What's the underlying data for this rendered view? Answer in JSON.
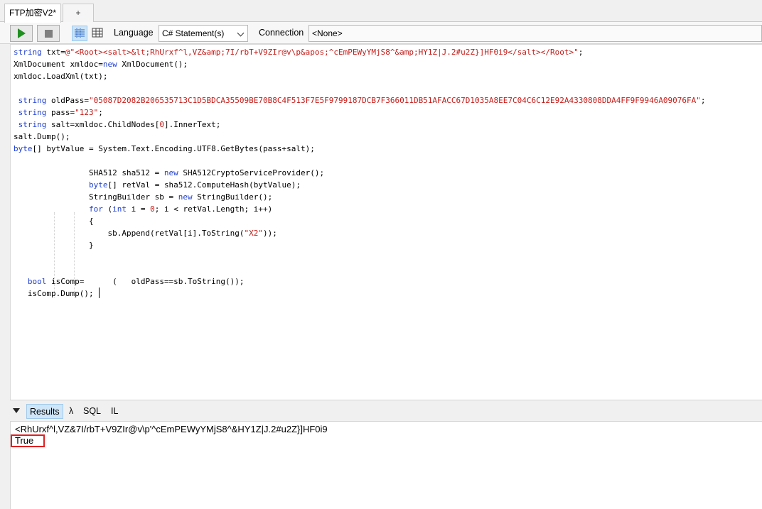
{
  "tabs": {
    "active_label": "FTP加密V2*",
    "new_tab_label": "+"
  },
  "toolbar": {
    "language_label": "Language",
    "language_value": "C# Statement(s)",
    "connection_label": "Connection",
    "connection_value": "<None>"
  },
  "editor": {
    "code_lines": [
      "string txt=@\"<Root><salt>&lt;RhUrxf^l,VZ&amp;7I/rbT+V9ZIr@v\\p&apos;^cEmPEWyYMjS8^&amp;HY1Z|J.2#u2Z}]HF0i9</salt></Root>\";",
      "XmlDocument xmldoc=new XmlDocument();",
      "xmldoc.LoadXml(txt);",
      "",
      " string oldPass=\"05087D2082B206535713C1D5BDCA35509BE70B8C4F513F7E5F9799187DCB7F366011DB51AFACC67D1035A8EE7C04C6C12E92A4330808DDA4FF9F9946A09076FA\";",
      " string pass=\"123\";",
      " string salt=xmldoc.ChildNodes[0].InnerText;",
      "salt.Dump();",
      "byte[] bytValue = System.Text.Encoding.UTF8.GetBytes(pass+salt);",
      "",
      "                SHA512 sha512 = new SHA512CryptoServiceProvider();",
      "                byte[] retVal = sha512.ComputeHash(bytValue);",
      "                StringBuilder sb = new StringBuilder();",
      "                for (int i = 0; i < retVal.Length; i++)",
      "                {",
      "                    sb.Append(retVal[i].ToString(\"X2\"));",
      "                }",
      "",
      "",
      "   bool isComp=      (   oldPass==sb.ToString());",
      "   isComp.Dump();"
    ]
  },
  "results": {
    "tabs": [
      "Results",
      "λ",
      "SQL",
      "IL"
    ],
    "output_lines": [
      "<RhUrxf^l,VZ&7I/rbT+V9ZIr@v\\p'^cEmPEWyYMjS8^&HY1Z|J.2#u2Z}]HF0i9",
      "True"
    ]
  },
  "colors": {
    "keyword": "#1f3fd1",
    "string": "#c41a16",
    "highlight_box": "#e02020",
    "run_green": "#1f8f1f"
  },
  "icons": [
    "play-icon",
    "stop-icon",
    "rich-text-view-icon",
    "grid-view-icon",
    "chevron-down-icon",
    "collapse-triangle-icon"
  ]
}
